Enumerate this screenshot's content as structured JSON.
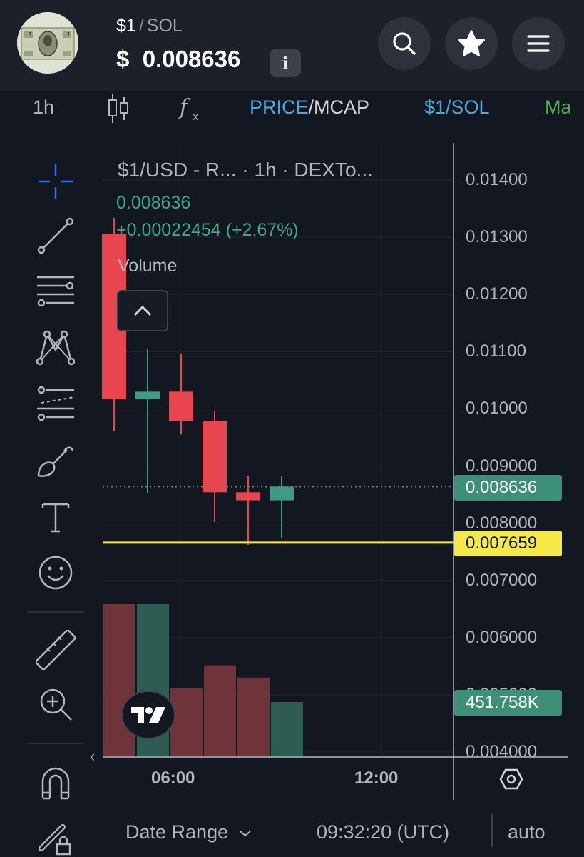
{
  "header": {
    "pair_base": "$1",
    "pair_slash": "/",
    "pair_quote": "SOL",
    "price_symbol": "$",
    "price_value": "0.008636",
    "avatar_icon": "dollar-bill-avatar",
    "info_icon": "info-icon",
    "buttons": [
      "search-icon",
      "star-icon",
      "menu-icon"
    ]
  },
  "toolbar": {
    "interval": "1h",
    "candles_icon": "candles-icon",
    "indicators_icon": "fx-icon",
    "price_label": "PRICE",
    "slash": "/",
    "mcap_label": "MCAP",
    "pair_label": "$1/SOL",
    "more_label": "Ma"
  },
  "tools": [
    "crosshair-icon",
    "trend-line-icon",
    "fib-icon",
    "pattern-icon",
    "projection-icon",
    "brush-icon",
    "text-icon",
    "emoji-icon",
    "ruler-icon",
    "zoom-in-icon",
    "magnet-icon",
    "lock-drawing-icon"
  ],
  "legend": {
    "title": "$1/USD - R... · 1h · DEXTo...",
    "price": "0.008636",
    "change": "+0.00022454 (+2.67%)",
    "volume_label": "Volume",
    "collapse_icon": "chevron-up-icon"
  },
  "colors": {
    "up": "#3f9b82",
    "down": "#e8454f",
    "alert_line": "#f5e94a",
    "background": "#131722"
  },
  "chart_data": {
    "type": "candlestick",
    "interval": "1h",
    "y_tick_labels": [
      "0.01400",
      "0.01300",
      "0.01200",
      "0.01100",
      "0.01000",
      "0.009000",
      "0.008000",
      "0.007000",
      "0.006000",
      "0.005000",
      "0.004000"
    ],
    "ylim": [
      0.00395,
      0.01435
    ],
    "x_tick_labels": [
      "06:00",
      "12:00"
    ],
    "candles": [
      {
        "open": 0.01306,
        "high": 0.01334,
        "low": 0.00961,
        "close": 0.01017
      },
      {
        "open": 0.01017,
        "high": 0.01105,
        "low": 0.00852,
        "close": 0.0103
      },
      {
        "open": 0.0103,
        "high": 0.01097,
        "low": 0.00955,
        "close": 0.00979
      },
      {
        "open": 0.00979,
        "high": 0.00997,
        "low": 0.00802,
        "close": 0.00854
      },
      {
        "open": 0.00854,
        "high": 0.00883,
        "low": 0.00762,
        "close": 0.0084
      },
      {
        "open": 0.0084,
        "high": 0.00883,
        "low": 0.00774,
        "close": 0.00864
      }
    ],
    "volume": [
      {
        "value": 1.0,
        "direction": "down"
      },
      {
        "value": 1.0,
        "direction": "up"
      },
      {
        "value": 0.45,
        "direction": "down"
      },
      {
        "value": 0.6,
        "direction": "down"
      },
      {
        "value": 0.52,
        "direction": "down"
      },
      {
        "value": 0.36,
        "direction": "up"
      }
    ],
    "last_price": 0.008636,
    "last_price_label": "0.008636",
    "alert_price": 0.007659,
    "alert_price_label": "0.007659",
    "volume_label": "451.758K",
    "grid": true
  },
  "bottom_bar": {
    "collapse_arrow": "‹",
    "date_range": "Date Range",
    "time": "09:32:20 (UTC)",
    "scale": "auto",
    "settings_icon": "hexagon-settings-icon"
  }
}
